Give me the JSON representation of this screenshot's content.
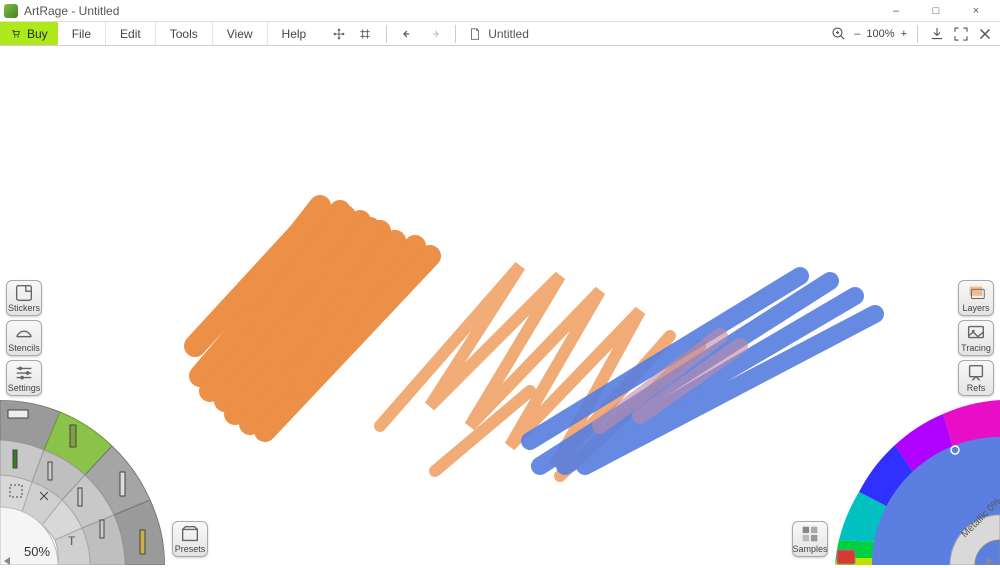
{
  "window": {
    "title": "ArtRage - Untitled",
    "controls": {
      "minimize": "–",
      "maximize": "□",
      "close": "×"
    }
  },
  "menubar": {
    "buy": "Buy",
    "items": [
      "File",
      "Edit",
      "Tools",
      "View",
      "Help"
    ],
    "document_label": "Untitled",
    "zoom_label": "100%"
  },
  "left_panels": {
    "stickers": "Stickers",
    "stencils": "Stencils",
    "settings": "Settings"
  },
  "right_panels": {
    "layers": "Layers",
    "tracing": "Tracing",
    "refs": "Refs"
  },
  "bottom_left": {
    "presets": "Presets",
    "size_label": "50%"
  },
  "bottom_right": {
    "samples": "Samples",
    "metallic_label": "Metallic 0%"
  },
  "colors": {
    "accent_green": "#aee81d",
    "stroke_orange": "#ec8a3e",
    "stroke_orange_light": "#f0a368",
    "stroke_blue": "#5a7fe0",
    "current_swatch": "#d73a2e"
  },
  "tool_wheel": {
    "tools": [
      "oil-brush",
      "watercolor",
      "palette-knife",
      "airbrush",
      "ink-pen",
      "pencil",
      "marker",
      "crayon",
      "chalk",
      "roller",
      "tube",
      "glitter",
      "eraser",
      "select",
      "transform",
      "text"
    ],
    "selected": "oil-brush",
    "selected_color": "#8bc34a"
  }
}
